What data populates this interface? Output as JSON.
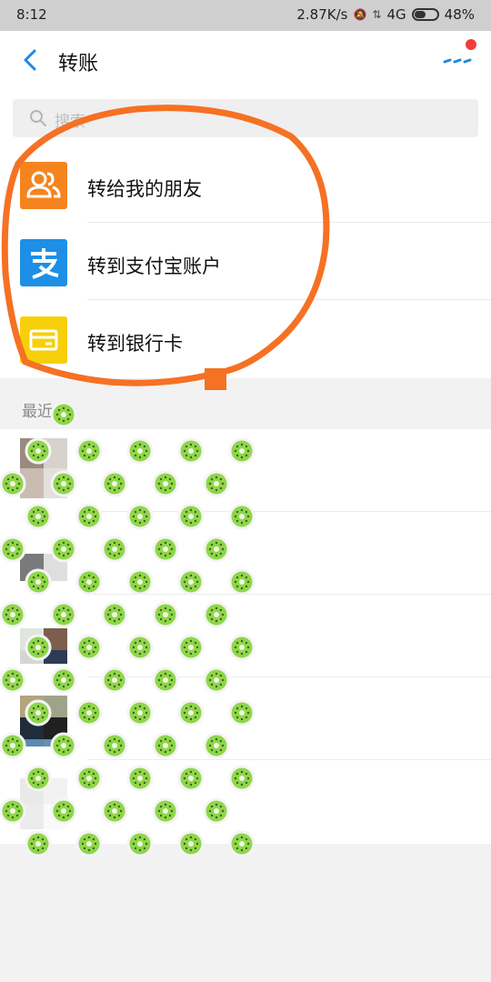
{
  "status": {
    "time": "8:12",
    "net_speed": "2.87K/s",
    "network": "4G",
    "battery": "48%",
    "battery_level": 0.48
  },
  "header": {
    "title": "转账"
  },
  "search": {
    "placeholder": "搜索"
  },
  "options": [
    {
      "label": "转给我的朋友",
      "icon": "friend-icon",
      "color": "#f5841f"
    },
    {
      "label": "转到支付宝账户",
      "icon": "alipay-icon",
      "color": "#1e8fe6"
    },
    {
      "label": "转到银行卡",
      "icon": "bank-card-icon",
      "color": "#f7cf0a"
    }
  ],
  "recent": {
    "heading": "最近"
  },
  "colors": {
    "accent": "#1e88e5",
    "annotation": "#f57123",
    "sticker": "#8fd64a"
  }
}
